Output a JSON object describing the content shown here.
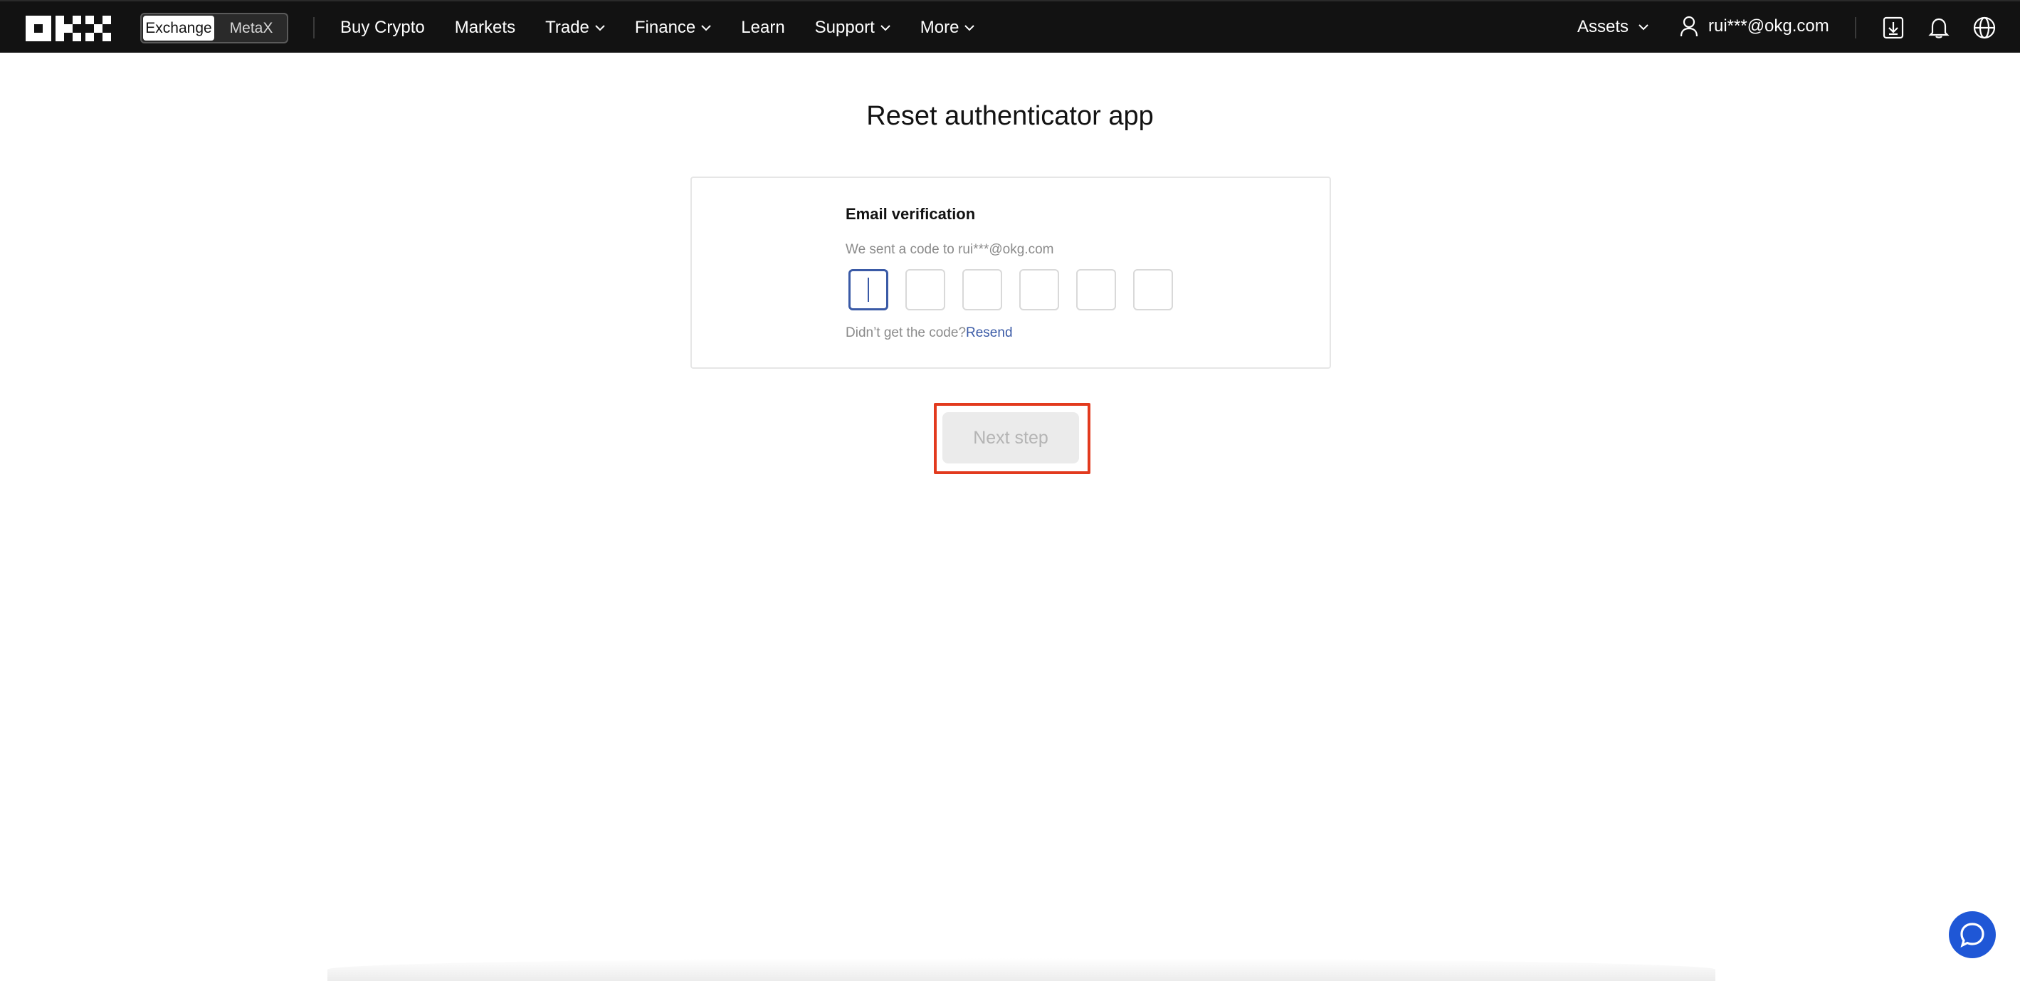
{
  "header": {
    "brand": "OKX",
    "switcher": {
      "options": [
        "Exchange",
        "MetaX"
      ],
      "active": "Exchange"
    },
    "nav": [
      {
        "label": "Buy Crypto",
        "has_dropdown": false
      },
      {
        "label": "Markets",
        "has_dropdown": false
      },
      {
        "label": "Trade",
        "has_dropdown": true
      },
      {
        "label": "Finance",
        "has_dropdown": true
      },
      {
        "label": "Learn",
        "has_dropdown": false
      },
      {
        "label": "Support",
        "has_dropdown": true
      },
      {
        "label": "More",
        "has_dropdown": true
      }
    ],
    "assets_label": "Assets",
    "account_label": "rui***@okg.com",
    "icons": [
      "download-icon",
      "bell-icon",
      "globe-icon"
    ]
  },
  "main": {
    "title": "Reset authenticator app",
    "card": {
      "heading": "Email verification",
      "subtext": "We sent a code to rui***@okg.com",
      "code_length": 6,
      "code_digits": [
        "",
        "",
        "",
        "",
        "",
        ""
      ],
      "resend_prompt": "Didn’t get the code?",
      "resend_link": "Resend"
    },
    "next_button": {
      "label": "Next step",
      "disabled": true
    }
  },
  "colors": {
    "topbar": "#121212",
    "accent": "#3a5aa6",
    "highlight": "#e23a1e",
    "chat": "#1f57d6",
    "button_disabled_bg": "#ebebeb",
    "button_disabled_text": "#b4b4b4"
  }
}
